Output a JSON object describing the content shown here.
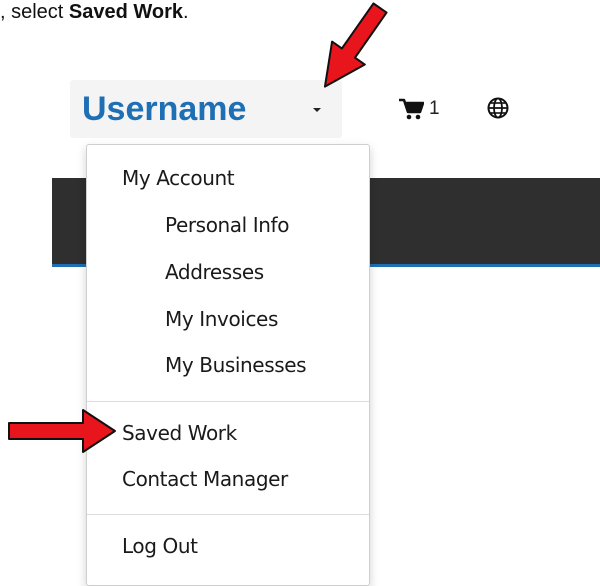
{
  "instruction": {
    "prefix": ", select ",
    "target": "Saved Work",
    "suffix": "."
  },
  "header": {
    "username": "Username",
    "cart_count": "1"
  },
  "menu": {
    "my_account": "My Account",
    "personal_info": "Personal Info",
    "addresses": "Addresses",
    "my_invoices": "My Invoices",
    "my_businesses": "My Businesses",
    "saved_work": "Saved Work",
    "contact_manager": "Contact Manager",
    "log_out": "Log Out"
  },
  "icons": {
    "cart": "shopping-cart-icon",
    "globe": "globe-icon",
    "caret": "caret-down-icon",
    "annotation_arrows": "red-arrow-icon"
  },
  "colors": {
    "username": "#1f6fb5",
    "nav_bar": "#2f2f2f",
    "nav_accent": "#1f6fb5",
    "annotation_arrow": "#e8151c"
  }
}
